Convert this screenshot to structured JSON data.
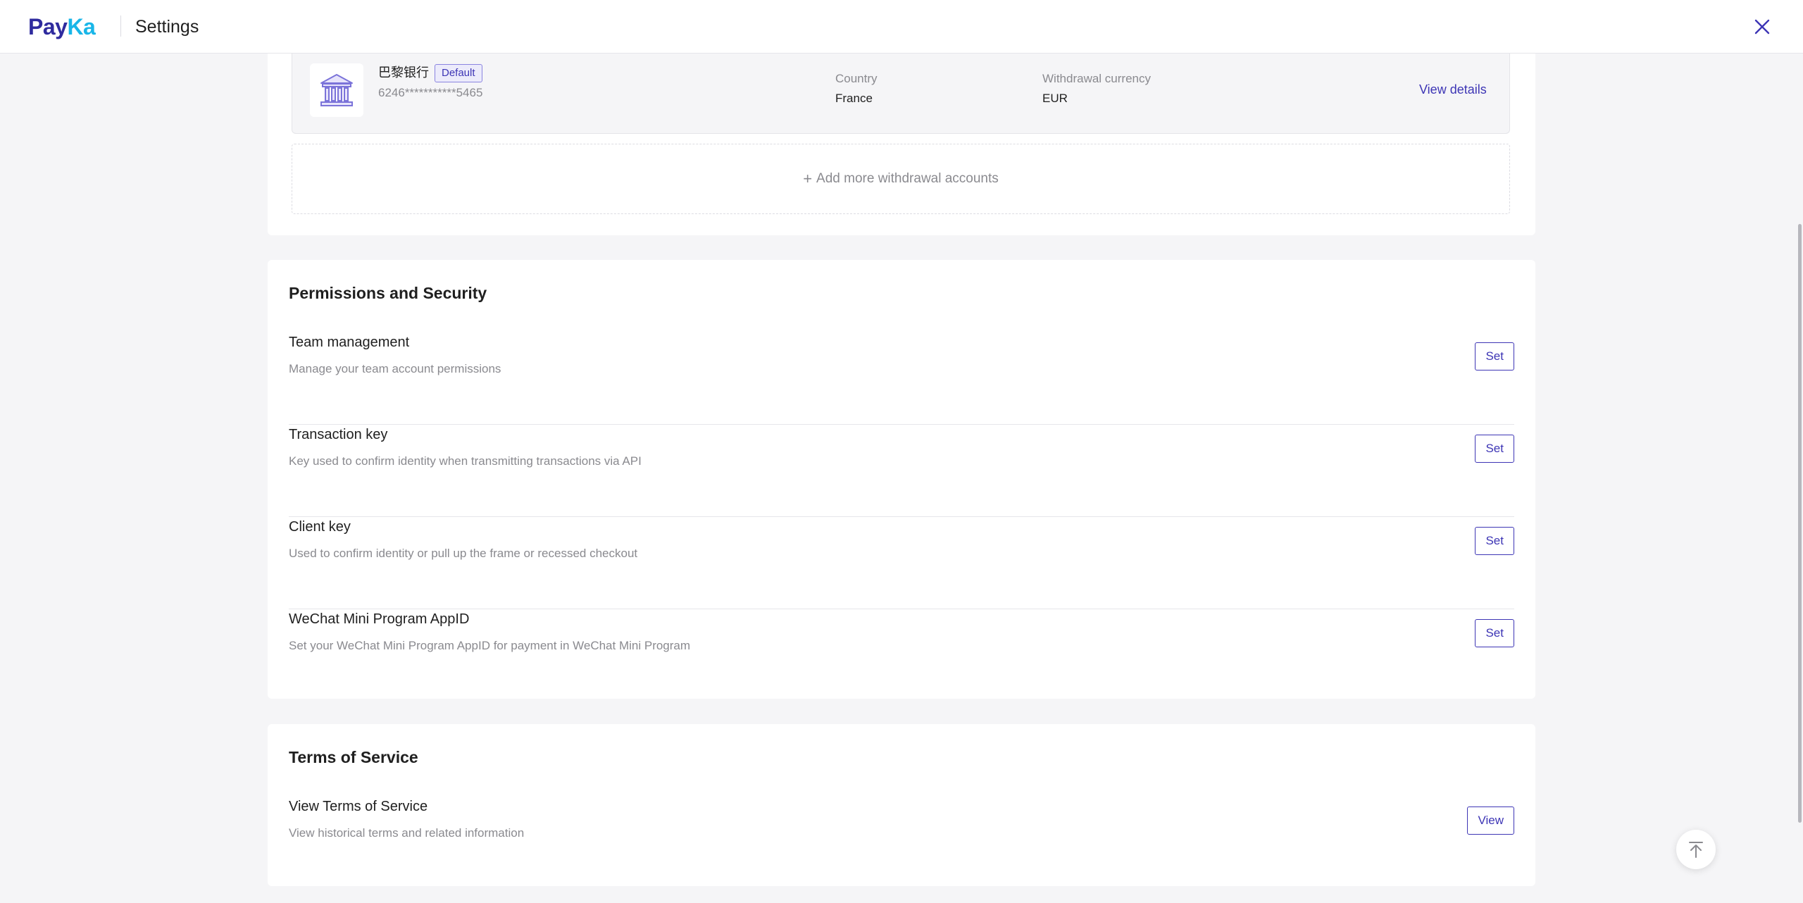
{
  "header": {
    "logo_part1": "Pay",
    "logo_part2": "Ka",
    "title": "Settings",
    "close_icon": "close-icon"
  },
  "withdrawal_accounts": {
    "account": {
      "bank_name": "巴黎银行",
      "badge": "Default",
      "account_number": "6246***********5465",
      "country_label": "Country",
      "country_value": "France",
      "currency_label": "Withdrawal currency",
      "currency_value": "EUR",
      "view_details": "View details",
      "icon": "bank-icon"
    },
    "add_more_label": "Add more withdrawal accounts",
    "add_icon": "plus-icon"
  },
  "permissions": {
    "title": "Permissions and Security",
    "items": [
      {
        "title": "Team management",
        "description": "Manage your team account permissions",
        "button": "Set"
      },
      {
        "title": "Transaction key",
        "description": "Key used to confirm identity when transmitting transactions via API",
        "button": "Set"
      },
      {
        "title": "Client key",
        "description": "Used to confirm identity or pull up the frame or recessed checkout",
        "button": "Set"
      },
      {
        "title": "WeChat Mini Program AppID",
        "description": "Set your WeChat Mini Program AppID for payment in WeChat Mini Program",
        "button": "Set"
      }
    ]
  },
  "terms": {
    "title": "Terms of Service",
    "items": [
      {
        "title": "View Terms of Service",
        "description": "View historical terms and related information",
        "button": "View"
      }
    ]
  },
  "colors": {
    "brand_primary": "#2f2b9e",
    "brand_accent": "#19b6e8",
    "link": "#3d35b5",
    "muted_text": "#8a8a8f",
    "page_bg": "#f5f5f7"
  },
  "back_to_top_icon": "arrow-up-to-top-icon"
}
